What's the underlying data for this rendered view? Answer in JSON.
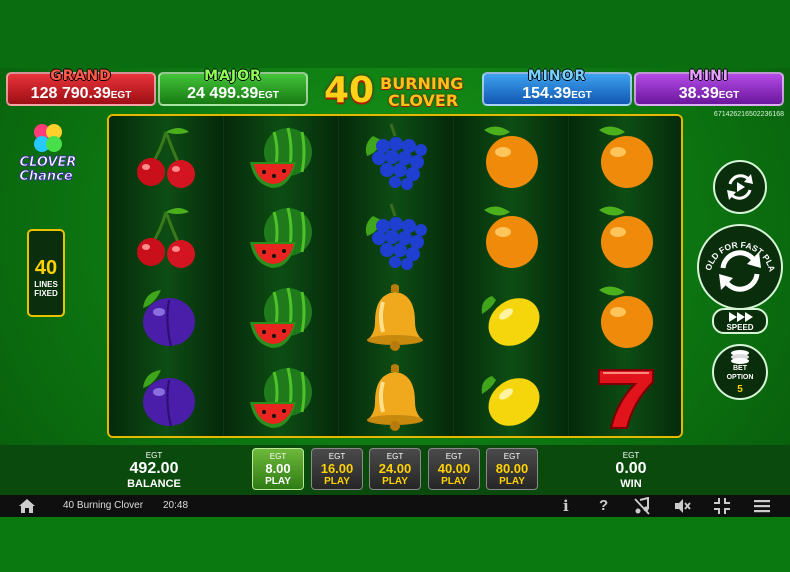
{
  "jackpots": {
    "grand": {
      "title": "GRAND",
      "value": "128 790.39",
      "currency": "EGT"
    },
    "major": {
      "title": "MAJOR",
      "value": "24 499.39",
      "currency": "EGT"
    },
    "minor": {
      "title": "MINOR",
      "value": "154.39",
      "currency": "EGT"
    },
    "mini": {
      "title": "MINI",
      "value": "38.39",
      "currency": "EGT"
    }
  },
  "game_title": {
    "number": "40",
    "line1": "BURNING",
    "line2": "CLOVER"
  },
  "serial": "6714262165022361​68",
  "logo": {
    "line1": "CLOVER",
    "line2": "Chance"
  },
  "lines": {
    "count": "40",
    "label1": "LINES",
    "label2": "FIXED"
  },
  "reels": [
    [
      "cherry-icon",
      "cherry-icon",
      "plum-icon",
      "plum-icon"
    ],
    [
      "watermelon-icon",
      "watermelon-icon",
      "watermelon-icon",
      "watermelon-icon"
    ],
    [
      "grapes-icon",
      "grapes-icon",
      "bell-icon",
      "bell-icon"
    ],
    [
      "orange-icon",
      "orange-icon",
      "lemon-icon",
      "lemon-icon"
    ],
    [
      "orange-icon",
      "orange-icon",
      "orange-icon",
      "seven-icon"
    ]
  ],
  "controls": {
    "hold_text": "HOLD FOR FAST PLAY",
    "speed_label": "SPEED",
    "bet_option_label1": "BET",
    "bet_option_label2": "OPTION",
    "bet_option_value": "5"
  },
  "balance": {
    "currency": "EGT",
    "value": "492.00",
    "label": "BALANCE"
  },
  "win": {
    "currency": "EGT",
    "value": "0.00",
    "label": "WIN"
  },
  "bets": [
    {
      "currency": "EGT",
      "value": "8.00",
      "label": "PLAY",
      "active": true
    },
    {
      "currency": "EGT",
      "value": "16.00",
      "label": "PLAY",
      "active": false
    },
    {
      "currency": "EGT",
      "value": "24.00",
      "label": "PLAY",
      "active": false
    },
    {
      "currency": "EGT",
      "value": "40.00",
      "label": "PLAY",
      "active": false
    },
    {
      "currency": "EGT",
      "value": "80.00",
      "label": "PLAY",
      "active": false
    }
  ],
  "status_bar": {
    "game_name": "40 Burning Clover",
    "time": "20:48",
    "info": "i",
    "help": "?"
  },
  "colors": {
    "frame": "#e7b800",
    "active_bet": "#2f7c15",
    "accent": "#ffd200"
  }
}
